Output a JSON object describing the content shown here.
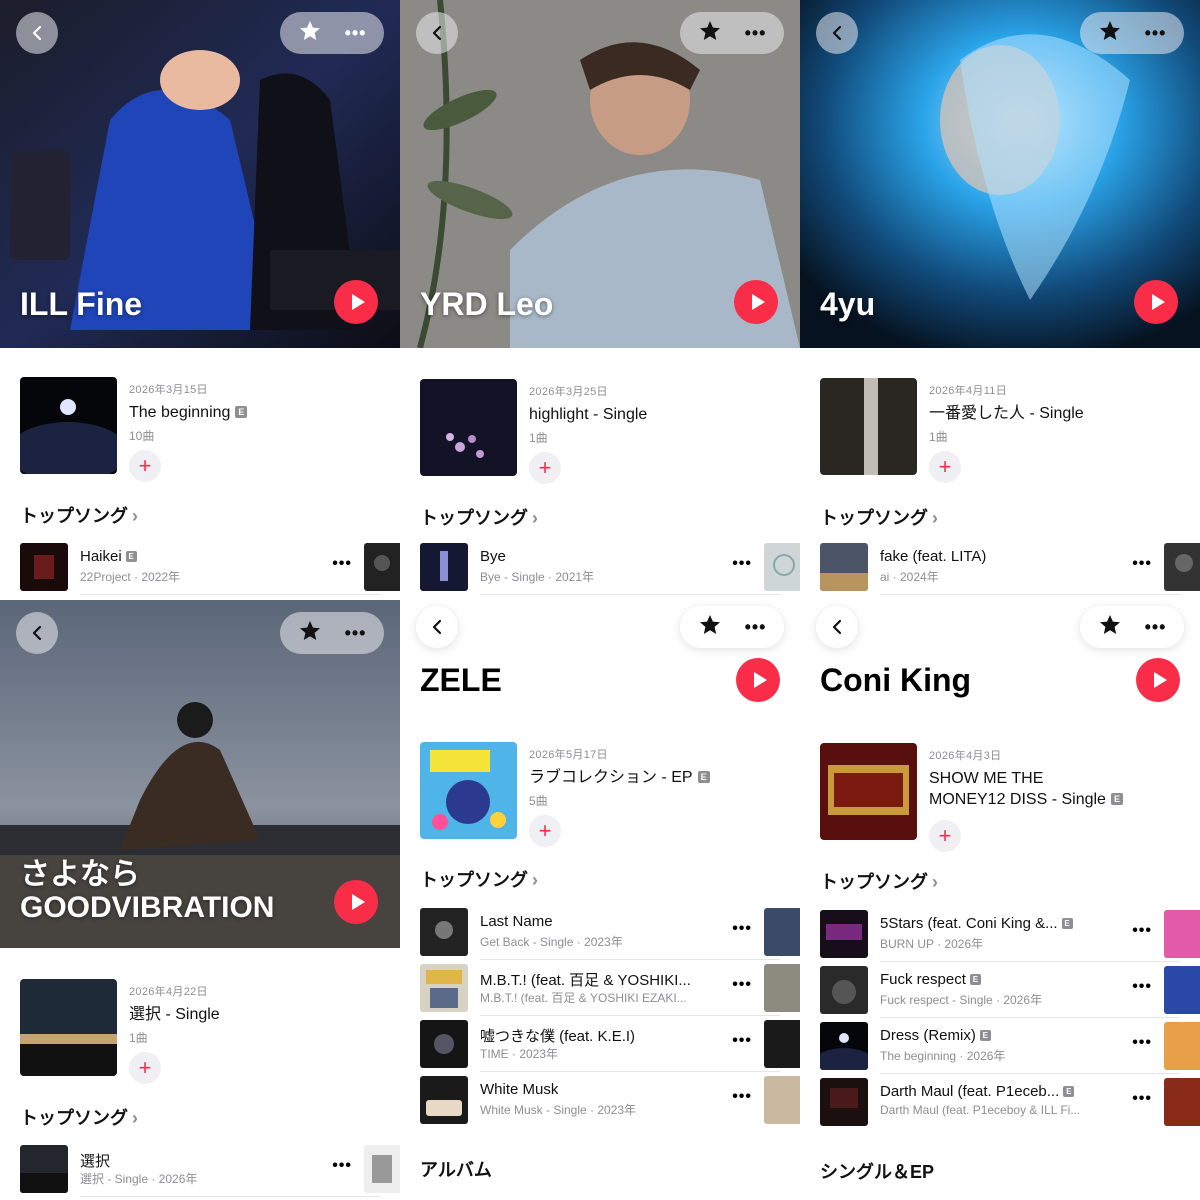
{
  "icons": {
    "back": "chevron-left-icon",
    "star": "star-icon",
    "more": "ellipsis-icon",
    "play": "play-icon",
    "add": "plus-icon",
    "explicit": "explicit-badge"
  },
  "colors": {
    "accent": "#fa2d48",
    "secondary_text": "#8e8e93",
    "add_bg": "#efeff4"
  },
  "common": {
    "top_songs": "トップソング",
    "chev": "›",
    "add": "+",
    "more": "•••",
    "e": "E"
  },
  "panels": [
    {
      "artist": "ILL Fine",
      "latest": {
        "date": "2026年3月15日",
        "title": "The beginning",
        "tracks": "10曲"
      },
      "songs": [
        {
          "title": "Haikei",
          "sub": "22Project · 2022年"
        }
      ]
    },
    {
      "artist": "YRD Leo",
      "latest": {
        "date": "2026年3月25日",
        "title": "highlight - Single",
        "tracks": "1曲"
      },
      "songs": [
        {
          "title": "Bye",
          "sub": "Bye - Single · 2021年"
        }
      ]
    },
    {
      "artist": "4yu",
      "latest": {
        "date": "2026年4月11日",
        "title": "一番愛した人 - Single",
        "tracks": "1曲"
      },
      "songs": [
        {
          "title": "fake (feat. LITA)",
          "sub": "ai · 2024年"
        }
      ]
    },
    {
      "artist": "さよなら\nGOODVIBRATION",
      "latest": {
        "date": "2026年4月22日",
        "title": "選択 - Single",
        "tracks": "1曲"
      },
      "songs": [
        {
          "title": "選択",
          "sub": "選択 - Single · 2026年"
        }
      ]
    },
    {
      "artist": "ZELE",
      "latest": {
        "date": "2026年5月17日",
        "title": "ラブコレクション - EP",
        "tracks": "5曲"
      },
      "songs": [
        {
          "title": "Last Name",
          "sub": "Get Back - Single · 2023年"
        },
        {
          "title": "M.B.T.! (feat. 百足 & YOSHIKI...",
          "sub": "M.B.T.! (feat. 百足 & YOSHIKI EZAKI..."
        },
        {
          "title": "嘘つきな僕 (feat. K.E.I)",
          "sub": "TIME · 2023年"
        },
        {
          "title": "White Musk",
          "sub": "White Musk - Single · 2023年"
        }
      ],
      "bottom_section": "アルバム"
    },
    {
      "artist": "Coni King",
      "latest": {
        "date": "2026年4月3日",
        "title": "SHOW ME THE",
        "title2": "MONEY12 DISS - Single",
        "tracks": ""
      },
      "songs": [
        {
          "title": "5Stars (feat. Coni King &...",
          "sub": "BURN UP · 2026年"
        },
        {
          "title": "Fuck respect",
          "sub": "Fuck respect - Single · 2026年"
        },
        {
          "title": "Dress (Remix)",
          "sub": "The beginning · 2026年"
        },
        {
          "title": "Darth Maul (feat. P1eceb...",
          "sub": "Darth Maul (feat. P1eceboy & ILL Fi..."
        }
      ],
      "bottom_section": "シングル＆EP"
    }
  ]
}
